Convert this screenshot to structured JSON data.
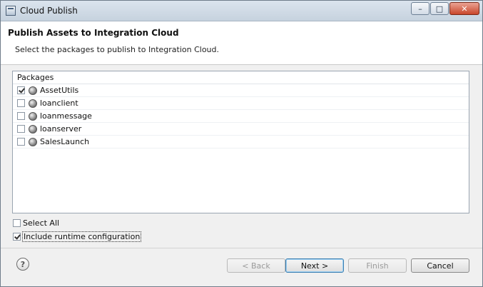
{
  "window": {
    "title": "Cloud Publish",
    "controls": {
      "minimize": "–",
      "maximize": "□",
      "close": "✕"
    }
  },
  "header": {
    "title": "Publish Assets to Integration Cloud",
    "subtitle": "Select the packages to publish to Integration Cloud."
  },
  "packages": {
    "heading": "Packages",
    "icon": "package-icon",
    "items": [
      {
        "label": "AssetUtils",
        "checked": true
      },
      {
        "label": "loanclient",
        "checked": false
      },
      {
        "label": "loanmessage",
        "checked": false
      },
      {
        "label": "loanserver",
        "checked": false
      },
      {
        "label": "SalesLaunch",
        "checked": false
      }
    ]
  },
  "options": {
    "select_all": {
      "label": "Select All",
      "checked": false
    },
    "include_runtime": {
      "label": "Include runtime configuration",
      "checked": true
    }
  },
  "footer": {
    "help_icon": "?",
    "back": "< Back",
    "next": "Next >",
    "finish": "Finish",
    "cancel": "Cancel"
  }
}
